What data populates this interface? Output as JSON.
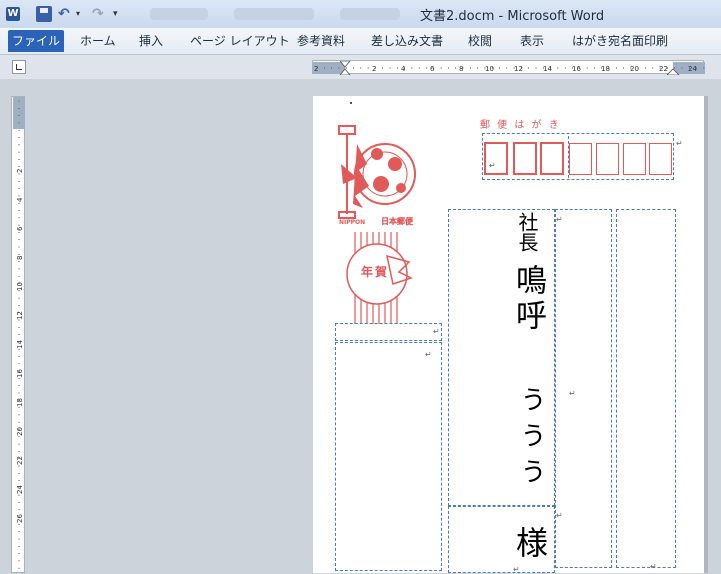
{
  "app_icon": "W",
  "window_title": "文書2.docm - Microsoft Word",
  "ribbon_tabs": [
    "ファイル",
    "ホーム",
    "挿入",
    "ページ レイアウト",
    "参考資料",
    "差し込み文書",
    "校閲",
    "表示",
    "はがき宛名面印刷"
  ],
  "ruler": {
    "horizontal_numbers": [
      "2",
      "2",
      "4",
      "6",
      "8",
      "10",
      "12",
      "14",
      "16",
      "18",
      "20",
      "22",
      "24"
    ],
    "vertical_numbers": [
      "2",
      "4",
      "6",
      "8",
      "10",
      "12",
      "14",
      "16",
      "18",
      "20",
      "22",
      "24",
      "26"
    ]
  },
  "postcard": {
    "heading": "郵 便 は が き",
    "stamp_brand": "NIPPON",
    "stamp_brand_jp": "日本郵便",
    "new_year_mark": "年賀",
    "recipient_title": "社長",
    "recipient_name_1": "鳴呼",
    "recipient_name_2": "ううう",
    "honorific": "様"
  },
  "colors": {
    "stamp_red": "#e05a5a",
    "frame_blue": "#4e7bb4",
    "file_tab": "#2b63b8"
  },
  "icons": [
    "word-app-icon",
    "save-icon",
    "undo-icon",
    "redo-icon",
    "paragraph-mark-icon"
  ]
}
